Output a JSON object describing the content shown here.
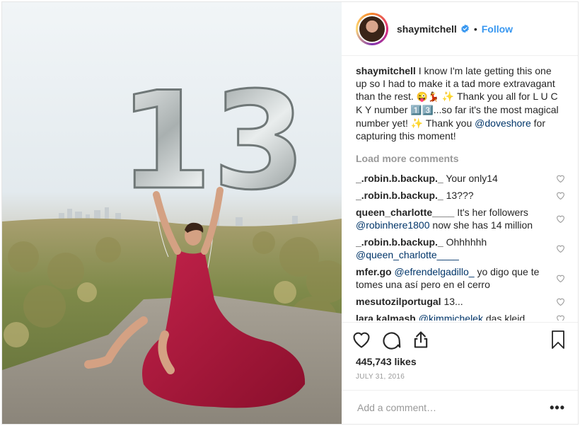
{
  "post": {
    "username": "shaymitchell",
    "follow_label": "Follow",
    "dot": "•",
    "caption": {
      "username": "shaymitchell",
      "text_1": "I know I'm late getting this one up so I had to make it a tad more extravagant than the rest. ",
      "emoji_1": "😜",
      "emoji_2": "💃",
      "text_2": " ✨ Thank you all for L U C K Y number ",
      "emoji_3": "1️⃣",
      "emoji_4": "3️⃣",
      "text_3": "...so far it's the most magical number yet! ✨ Thank you ",
      "mention": "@doveshore",
      "text_4": " for capturing this moment!"
    },
    "load_more_label": "Load more comments",
    "comments": [
      {
        "user": "_.robin.b.backup._",
        "text": "Your only14",
        "mention": ""
      },
      {
        "user": "_.robin.b.backup._",
        "text": "13???",
        "mention": ""
      },
      {
        "user": "queen_charlotte____",
        "text_before": "It's her followers",
        "mention": "@robinhere1800",
        "text_after": "now she has 14 million"
      },
      {
        "user": "_.robin.b.backup._",
        "text_before": "Ohhhhhh",
        "mention": "@queen_charlotte____",
        "text_after": ""
      },
      {
        "user": "mfer.go",
        "text_before": "",
        "mention": "@efrendelgadillo_",
        "text_after": "yo digo que te tomes una así pero en el cerro"
      },
      {
        "user": "mesutozilportugal",
        "text": "13...",
        "mention": ""
      },
      {
        "user": "lara.kalmash",
        "text_before": "",
        "mention": "@kimmichelek",
        "text_after": "das kleid"
      }
    ],
    "likes": "445,743 likes",
    "date": "JULY 31, 2016",
    "add_comment_placeholder": "Add a comment…",
    "more_label": "•••",
    "balloon_number": "13"
  },
  "colors": {
    "link_blue": "#3897f0",
    "mention_navy": "#003569",
    "muted": "#999999",
    "dress": "#b0173a"
  },
  "icons": [
    "verified-badge-icon",
    "heart-icon",
    "comment-icon",
    "share-icon",
    "bookmark-icon",
    "more-icon"
  ]
}
